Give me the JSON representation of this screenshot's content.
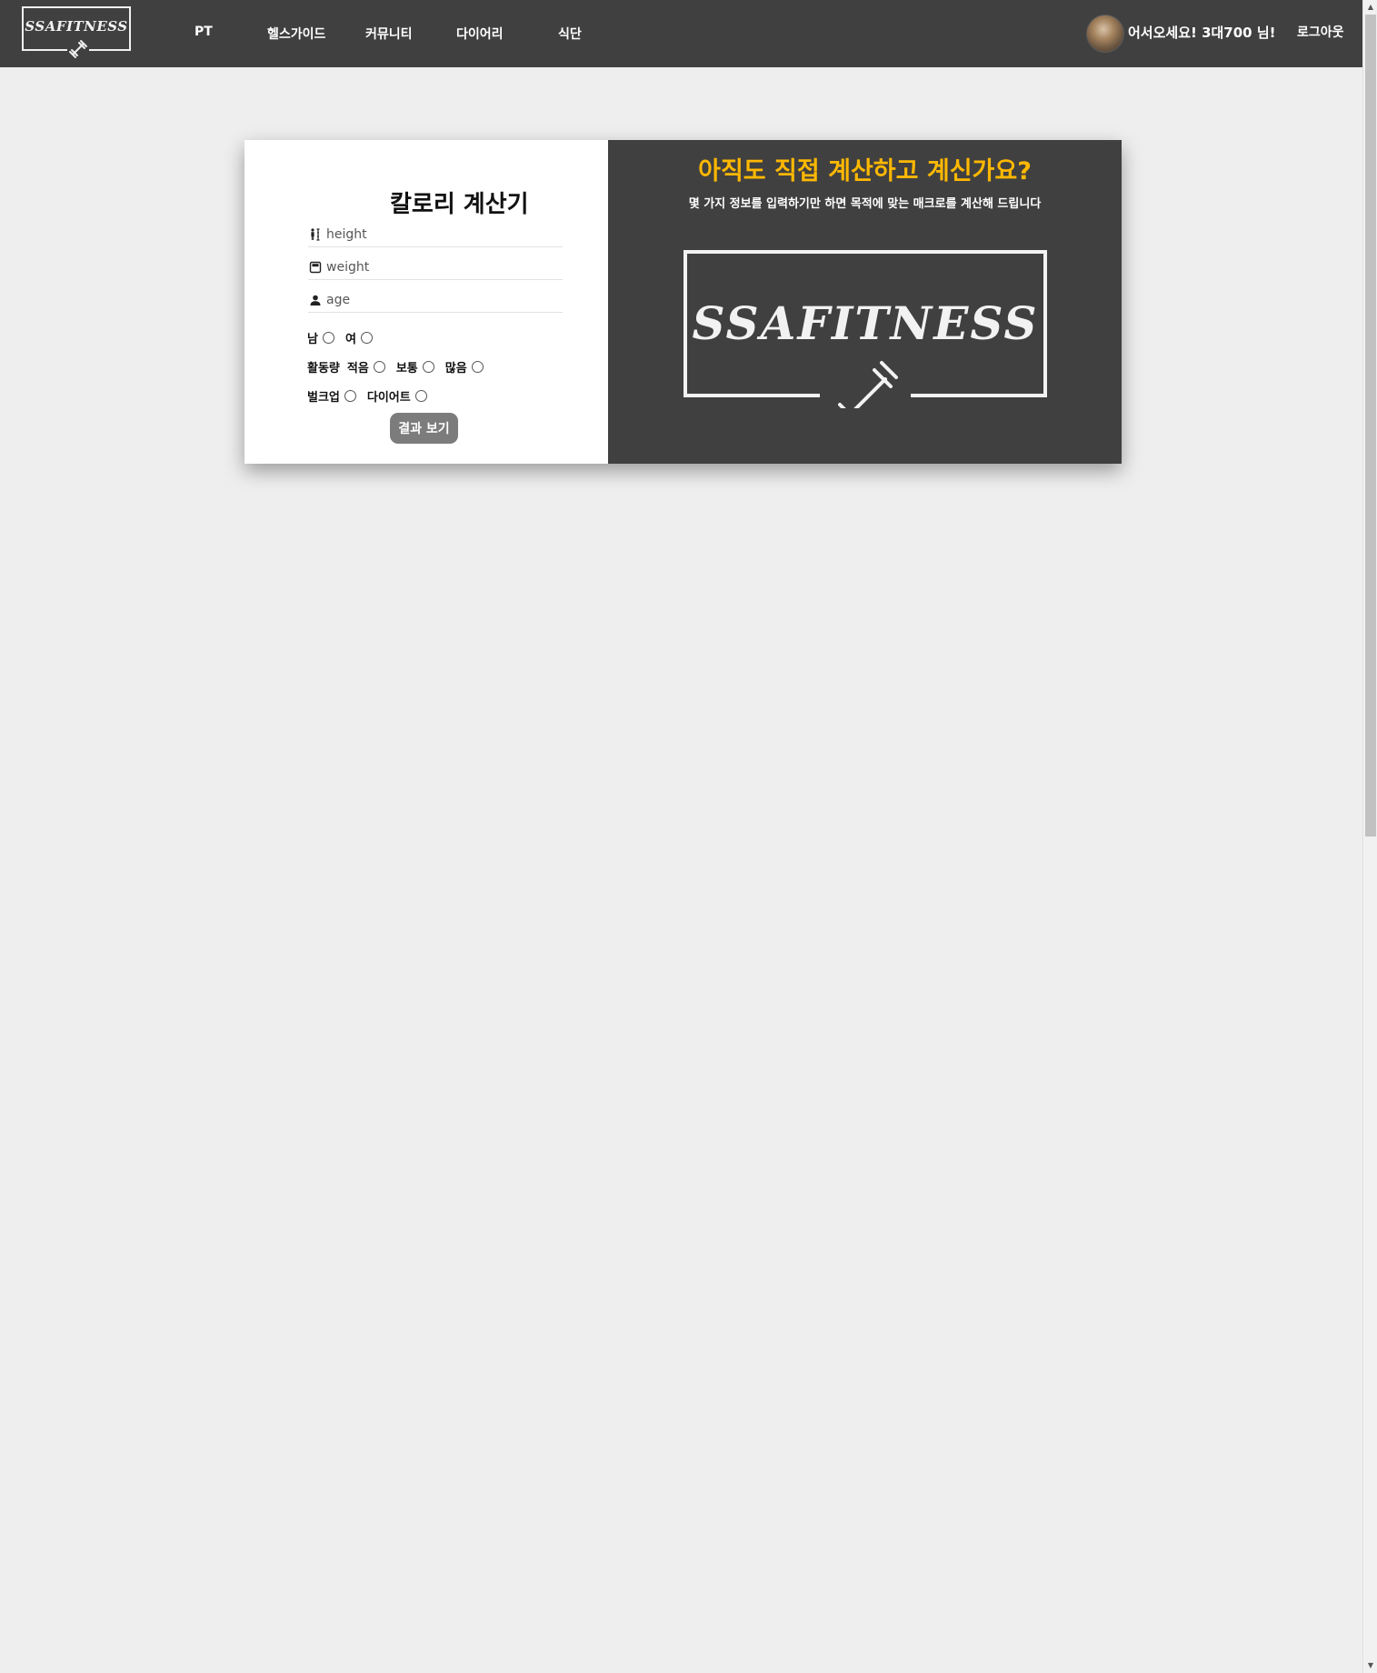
{
  "navbar": {
    "logo_text": "SSAFITNESS",
    "items": [
      {
        "label": "PT"
      },
      {
        "label": "헬스가이드"
      },
      {
        "label": "커뮤니티"
      },
      {
        "label": "다이어리"
      },
      {
        "label": "식단"
      }
    ],
    "welcome_text": "어서오세요! 3대700 님!",
    "logout_label": "로그아웃"
  },
  "calculator": {
    "title": "칼로리 계산기",
    "fields": {
      "height": {
        "placeholder": "height",
        "icon": "height-icon"
      },
      "weight": {
        "placeholder": "weight",
        "icon": "scale-icon"
      },
      "age": {
        "placeholder": "age",
        "icon": "person-icon"
      }
    },
    "gender": {
      "male": "남",
      "female": "여"
    },
    "activity": {
      "label": "활동량",
      "low": "적음",
      "mid": "보통",
      "high": "많음"
    },
    "goal": {
      "bulkup": "벌크업",
      "diet": "다이어트"
    },
    "submit_label": "결과 보기"
  },
  "promo": {
    "title": "아직도 직접 계산하고 계신가요?",
    "subtitle": "몇 가지 정보를 입력하기만 하면 목적에 맞는 매크로를 계산해 드립니다",
    "logo_text": "SSAFITNESS"
  },
  "colors": {
    "navbar_bg": "#404040",
    "page_bg": "#eeeeee",
    "accent_yellow": "#ffb800",
    "button_gray": "#7c7c7c"
  }
}
